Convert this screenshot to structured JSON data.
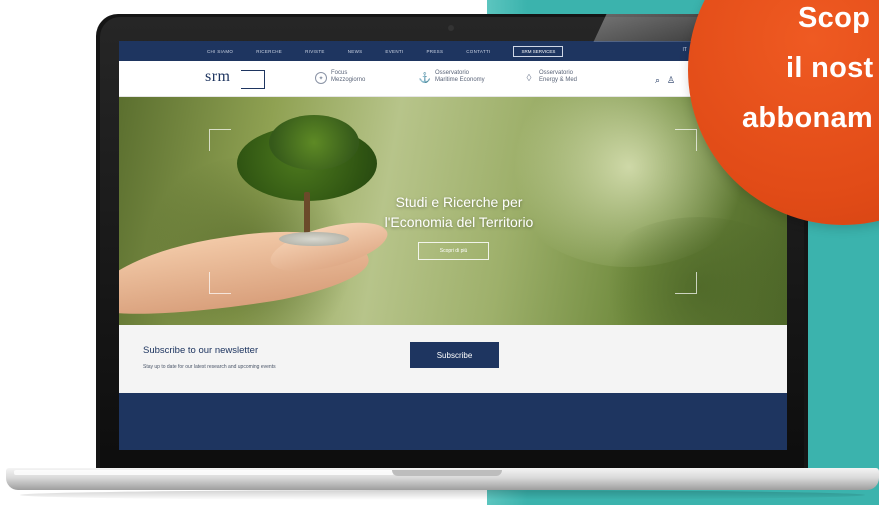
{
  "promo": {
    "line1": "Scop",
    "line2": "il nost",
    "line3": "abbonam",
    "color": "#e14b17"
  },
  "colors": {
    "navy": "#1e3560",
    "teal": "#3bb3ad",
    "orange": "#e14b17"
  },
  "website": {
    "topnav": {
      "items": [
        "Chi siamo",
        "Ricerche",
        "Riviste",
        "News",
        "Eventi",
        "Press",
        "Contatti"
      ],
      "button": "SRM Services",
      "lang": "IT"
    },
    "header": {
      "logo": "srm",
      "nav": [
        {
          "line1": "Focus",
          "line2": "Mezzogiorno",
          "icon": "compass-icon"
        },
        {
          "line1": "Osservatorio",
          "line2": "Maritime Economy",
          "icon": "anchor-icon"
        },
        {
          "line1": "Osservatorio",
          "line2": "Energy & Med",
          "icon": "drop-icon"
        }
      ]
    },
    "hero": {
      "title_line1": "Studi e Ricerche per",
      "title_line2": "l'Economia del Territorio",
      "button": "Scopri di più"
    },
    "newsletter": {
      "title": "Subscribe to our newsletter",
      "subtitle": "Stay up to date for our latest research and upcoming events",
      "button": "Subscribe"
    }
  }
}
